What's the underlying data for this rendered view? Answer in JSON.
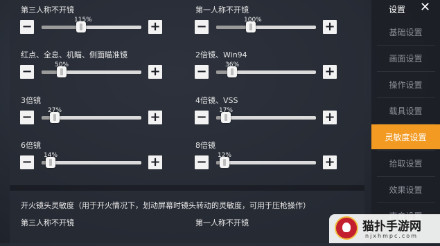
{
  "sliders": [
    {
      "title": "第三人称不开镜",
      "value_label": "115%",
      "value": 1.15,
      "max": 3.0
    },
    {
      "title": "第一人称不开镜",
      "value_label": "100%",
      "value": 1.0,
      "max": 3.0
    },
    {
      "title": "红点、全息、机瞄、侧面瞄准镜",
      "value_label": "50%",
      "value": 0.5,
      "max": 3.0
    },
    {
      "title": "2倍镜、Win94",
      "value_label": "36%",
      "value": 0.36,
      "max": 3.0
    },
    {
      "title": "3倍镜",
      "value_label": "27%",
      "value": 0.27,
      "max": 3.0
    },
    {
      "title": "4倍镜、VSS",
      "value_label": "17%",
      "value": 0.17,
      "max": 3.0
    },
    {
      "title": "6倍镜",
      "value_label": "14%",
      "value": 0.14,
      "max": 3.0
    },
    {
      "title": "8倍镜",
      "value_label": "12%",
      "value": 0.12,
      "max": 3.0
    }
  ],
  "fire_section": {
    "heading": "开火镜头灵敏度（用于开火情况下，划动屏幕时镜头转动的灵敏度，可用于压枪操作）",
    "left_title": "第三人称不开镜",
    "right_title": "第一人称不开镜"
  },
  "sidebar": {
    "title": "设置",
    "close": "✕",
    "items": [
      {
        "label": "基础设置"
      },
      {
        "label": "画面设置"
      },
      {
        "label": "操作设置"
      },
      {
        "label": "载具设置"
      },
      {
        "label": "灵敏度设置",
        "active": true
      },
      {
        "label": "拾取设置"
      },
      {
        "label": "效果设置"
      },
      {
        "label": "声音设置"
      }
    ]
  },
  "watermark": {
    "name": "猫扑手游网",
    "url": "njxhmpc.com"
  },
  "colors": {
    "accent": "#f29a22",
    "button": "#f2f2f2"
  }
}
